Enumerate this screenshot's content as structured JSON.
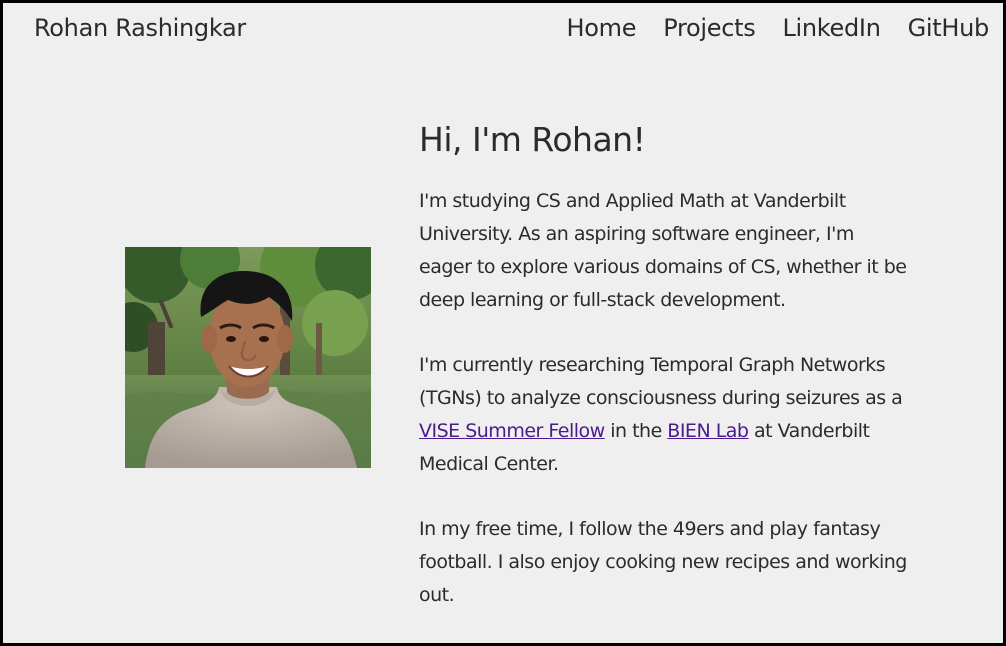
{
  "header": {
    "brand": "Rohan Rashingkar",
    "nav": [
      "Home",
      "Projects",
      "LinkedIn",
      "GitHub"
    ]
  },
  "hero": {
    "photo_label": "portrait-photo",
    "greeting": "Hi, I'm Rohan!",
    "paragraph1": "I'm studying CS and Applied Math at Vanderbilt University. As an aspiring software engineer, I'm eager to explore various domains of CS, whether it be deep learning or full-stack development.",
    "paragraph2": {
      "before": "I'm currently researching Temporal Graph Networks (TGNs) to analyze consciousness during seizures as a ",
      "link1": "VISE Summer Fellow",
      "middle": " in the ",
      "link2": "BIEN Lab",
      "after": " at Vanderbilt Medical Center."
    },
    "paragraph3": "In my free time, I follow the 49ers and play fantasy football. I also enjoy cooking new recipes and working out."
  },
  "colors": {
    "background": "#efefef",
    "text": "#2b2b2b",
    "link": "#4a1a8e"
  }
}
